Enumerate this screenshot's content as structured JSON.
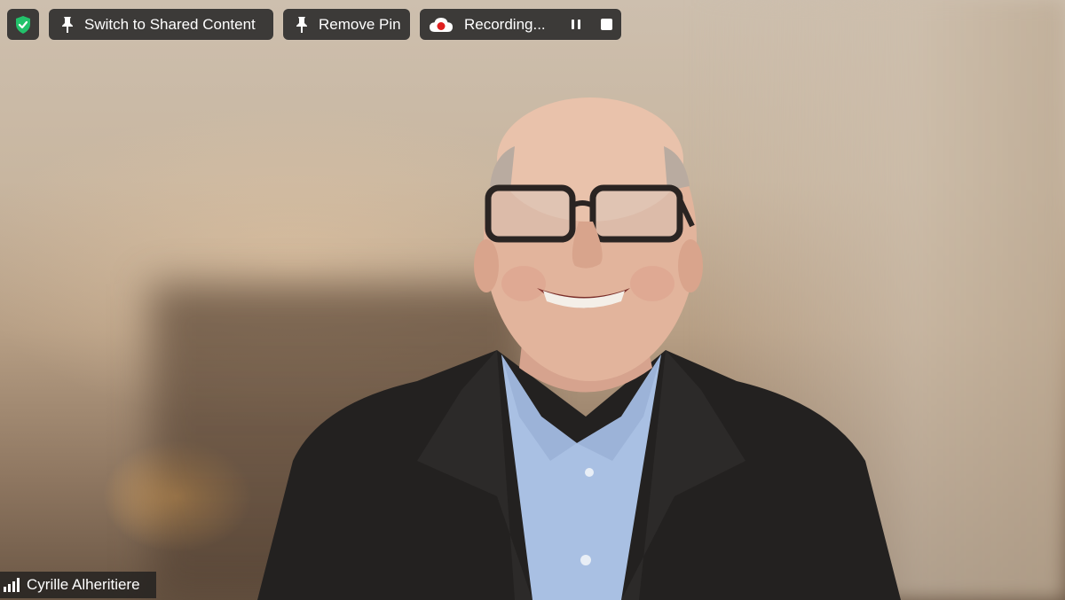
{
  "toolbar": {
    "security_icon": "shield-check-icon",
    "switch_label": "Switch to Shared Content",
    "remove_pin_label": "Remove Pin",
    "recording_label": "Recording...",
    "pin_icon": "pin-icon",
    "cloud_record_icon": "cloud-record-icon",
    "pause_icon": "pause-icon",
    "stop_icon": "stop-icon"
  },
  "participant": {
    "name": "Cyrille Alheritiere",
    "signal_icon": "signal-strength-icon"
  },
  "colors": {
    "shield": "#23c26b",
    "record_dot": "#e02020",
    "pill_bg": "#282828"
  }
}
